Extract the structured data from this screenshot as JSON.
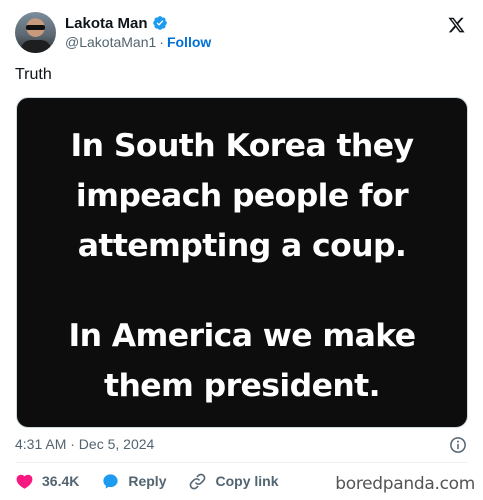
{
  "author": {
    "display_name": "Lakota Man",
    "handle": "@LakotaMan1",
    "separator": "·",
    "follow_label": "Follow"
  },
  "tweet": {
    "text": "Truth",
    "image_text": [
      "In South Korea they",
      "impeach people for",
      "attempting a coup.",
      "In America we make",
      "them president."
    ],
    "timestamp": "4:31 AM · Dec 5, 2024"
  },
  "actions": {
    "likes": "36.4K",
    "reply_label": "Reply",
    "copy_link_label": "Copy link"
  },
  "watermark": "boredpanda.com",
  "colors": {
    "accent": "#1d9bf0",
    "like": "#f91880",
    "muted": "#536471",
    "image_bg": "#0d0d0d"
  },
  "icons": {
    "verified": "verified-badge-icon",
    "brand": "x-logo-icon",
    "info": "info-icon",
    "like": "heart-icon",
    "reply": "reply-bubble-icon",
    "copy": "link-icon"
  }
}
